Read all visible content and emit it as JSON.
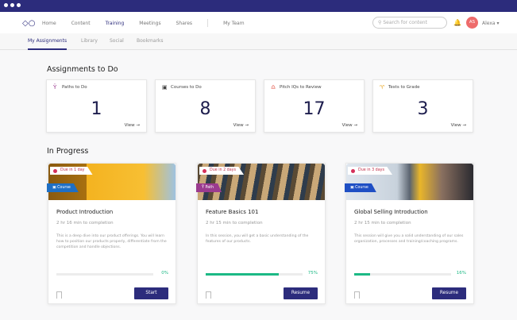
{
  "nav": {
    "items": [
      "Home",
      "Content",
      "Training",
      "Meetings",
      "Shares",
      "My Team"
    ],
    "active": "Training",
    "search_placeholder": "Search for content",
    "avatar_initials": "AS",
    "user_name": "Alexa ▾"
  },
  "subnav": {
    "items": [
      "My Assignments",
      "Library",
      "Social",
      "Bookmarks"
    ],
    "active": "My Assignments"
  },
  "assignments": {
    "title": "Assignments to Do",
    "cards": [
      {
        "label": "Paths to Do",
        "count": "1",
        "view": "View",
        "icon": "path-icon"
      },
      {
        "label": "Courses to Do",
        "count": "8",
        "view": "View",
        "icon": "course-icon"
      },
      {
        "label": "Pitch IQs to Review",
        "count": "17",
        "view": "View",
        "icon": "headset-icon"
      },
      {
        "label": "Tests to Grade",
        "count": "3",
        "view": "View",
        "icon": "trophy-icon"
      }
    ]
  },
  "in_progress": {
    "title": "In Progress",
    "cards": [
      {
        "due": "Due in 1 day",
        "type": "Course",
        "title": "Product Introduction",
        "duration": "2 hr 16 min to completion",
        "description": "This is a deep dive into our product offerings. You will learn how to position our products properly, differentiate from the competition and handle objections.",
        "progress": 0,
        "progress_label": "0%",
        "button": "Start"
      },
      {
        "due": "Due in 2 days",
        "type": "Path",
        "title": "Feature Basics 101",
        "duration": "2 hr 15 min to completion",
        "description": "In this session, you will get a basic understanding of the features of our products.",
        "progress": 75,
        "progress_label": "75%",
        "button": "Resume"
      },
      {
        "due": "Due in 3 days",
        "type": "Course",
        "title": "Global Selling Introduction",
        "duration": "2 hr 15 min to completion",
        "description": "This session will give you a solid understanding of our sales organization, processes and training/coaching programs.",
        "progress": 16,
        "progress_label": "16%",
        "button": "Resume"
      }
    ]
  },
  "colors": {
    "brand": "#2c2c7c",
    "progress": "#1cb985",
    "due": "#d5305a",
    "course": "#1f6fc4",
    "path": "#9b3b8f"
  }
}
